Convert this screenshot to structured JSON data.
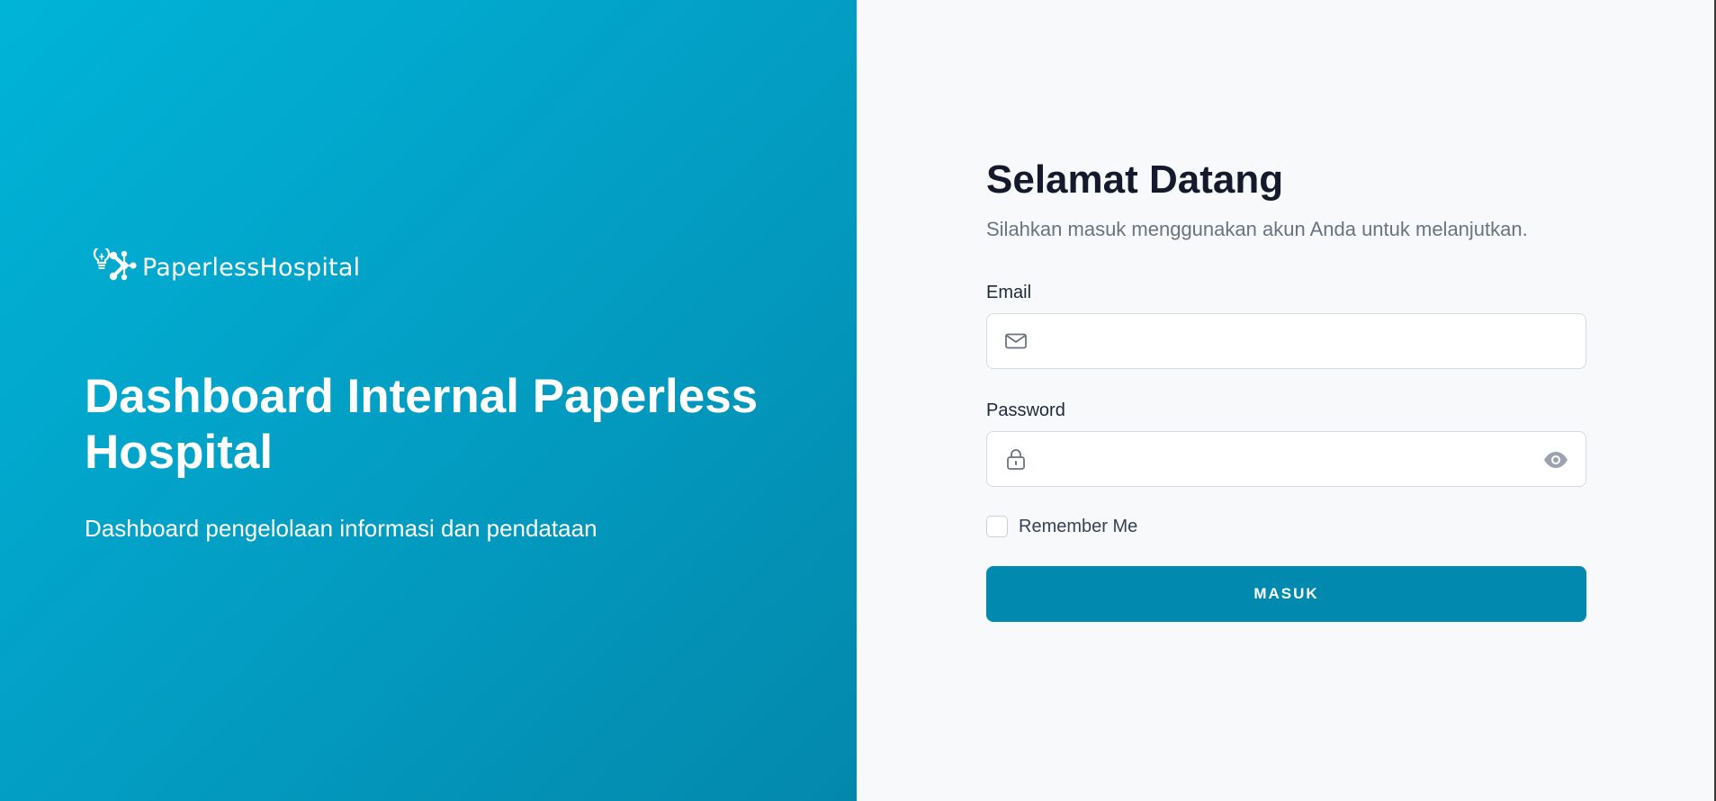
{
  "brand": {
    "name": "PaperlessHospital",
    "logo_icon": "lightbulb-network-icon"
  },
  "hero": {
    "title": "Dashboard Internal Paperless Hospital",
    "subtitle": "Dashboard pengelolaan informasi dan pendataan"
  },
  "login": {
    "title": "Selamat Datang",
    "subtitle": "Silahkan masuk menggunakan akun Anda untuk melanjutkan.",
    "email": {
      "label": "Email",
      "value": "",
      "placeholder": "",
      "icon": "envelope-icon"
    },
    "password": {
      "label": "Password",
      "value": "",
      "placeholder": "",
      "icon": "lock-icon",
      "toggle_icon": "eye-icon"
    },
    "remember_label": "Remember Me",
    "remember_checked": false,
    "submit_label": "MASUK"
  },
  "colors": {
    "hero_gradient_start": "#00b4d8",
    "hero_gradient_end": "#0388ac",
    "primary_button": "#0289b0",
    "title_text": "#141a2b",
    "muted_text": "#6b7280",
    "form_background": "#f8f9fb"
  }
}
